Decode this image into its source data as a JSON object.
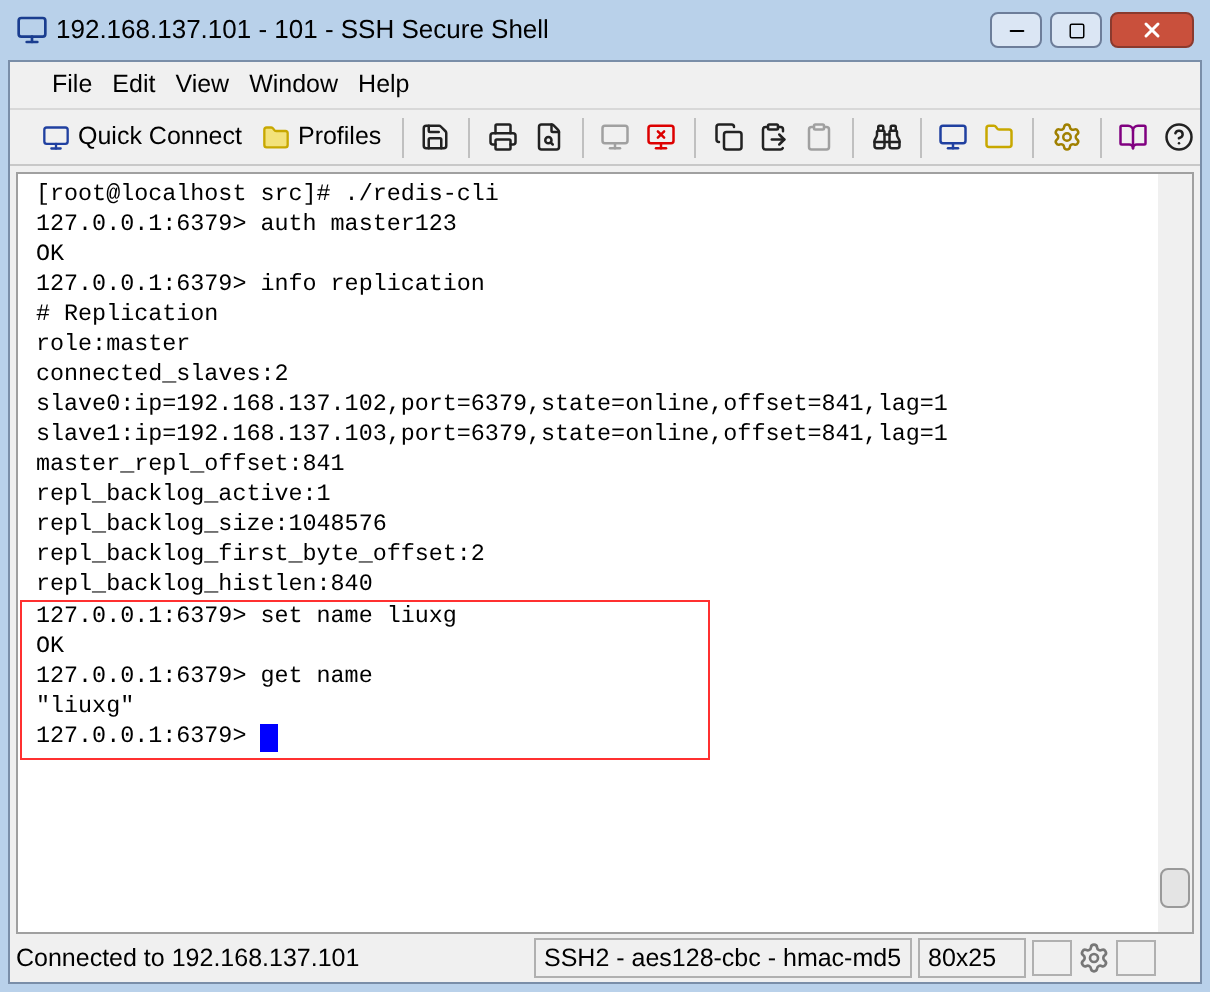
{
  "window": {
    "title": "192.168.137.101 - 101 - SSH Secure Shell"
  },
  "menu": [
    "File",
    "Edit",
    "View",
    "Window",
    "Help"
  ],
  "toolbar": {
    "quick_connect": "Quick Connect",
    "profiles": "Profiles"
  },
  "terminal": {
    "lines": [
      "[root@localhost src]# ./redis-cli",
      "127.0.0.1:6379> auth master123",
      "OK",
      "127.0.0.1:6379> info replication",
      "# Replication",
      "role:master",
      "connected_slaves:2",
      "slave0:ip=192.168.137.102,port=6379,state=online,offset=841,lag=1",
      "slave1:ip=192.168.137.103,port=6379,state=online,offset=841,lag=1",
      "master_repl_offset:841",
      "repl_backlog_active:1",
      "repl_backlog_size:1048576",
      "repl_backlog_first_byte_offset:2",
      "repl_backlog_histlen:840"
    ],
    "highlighted_lines": [
      "127.0.0.1:6379> set name liuxg",
      "OK",
      "127.0.0.1:6379> get name",
      "\"liuxg\"",
      "127.0.0.1:6379>"
    ],
    "cursor": true
  },
  "status_bar": {
    "connection": "Connected to 192.168.137.101",
    "cipher": "SSH2 - aes128-cbc - hmac-md5",
    "size": "80x25"
  }
}
